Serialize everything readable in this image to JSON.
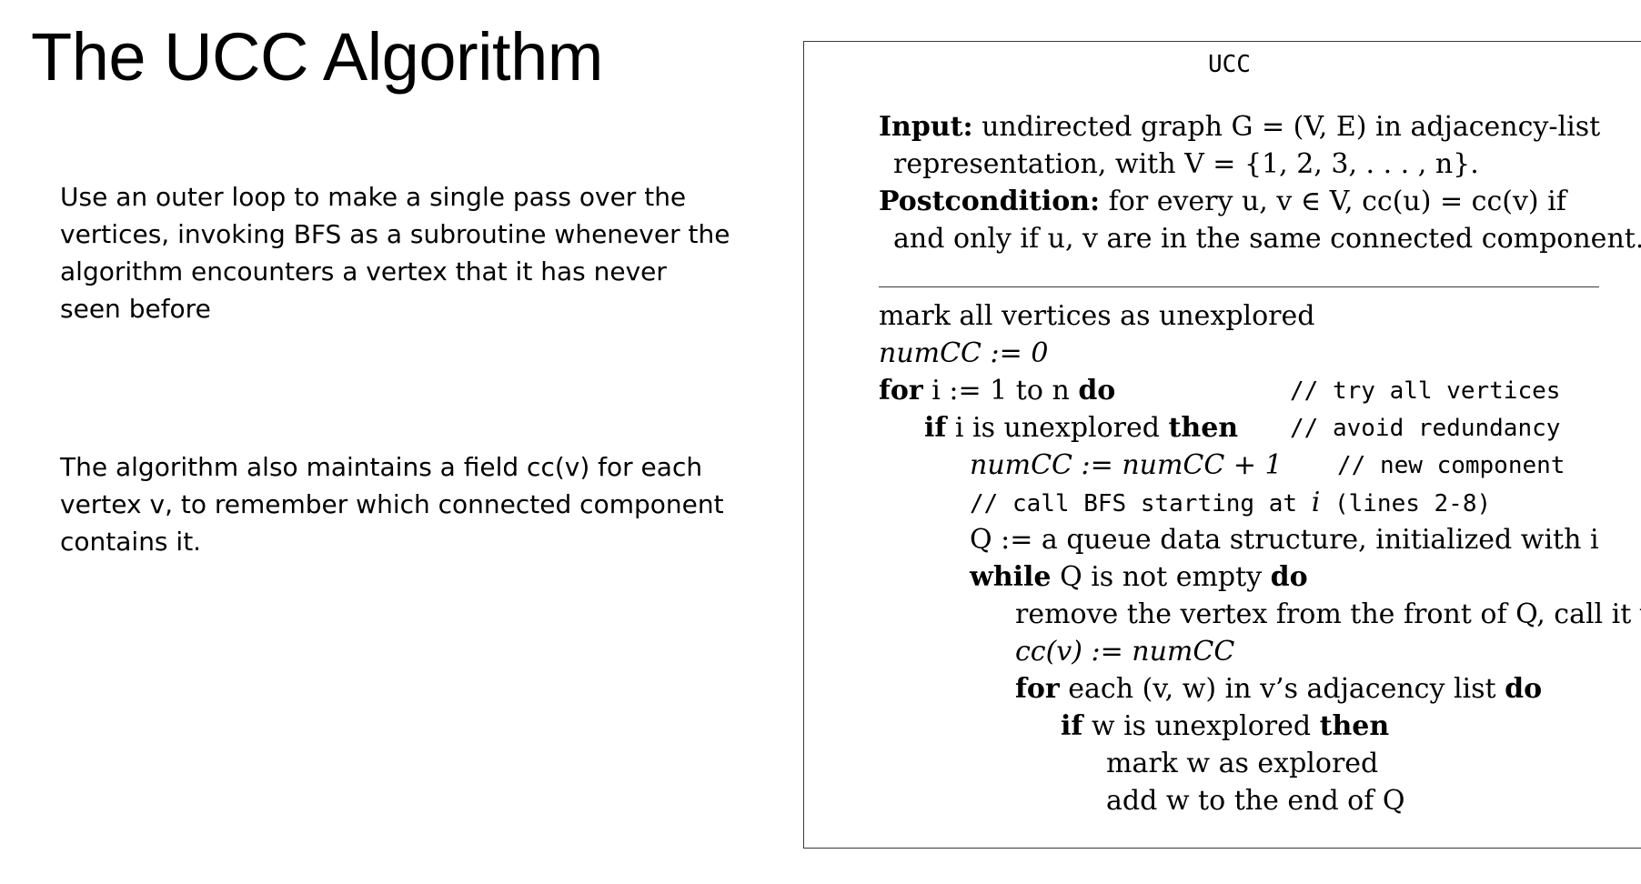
{
  "slide": {
    "title": "The UCC Algorithm",
    "paragraph_1": "Use an outer loop to make a single pass over the vertices, invoking BFS as a subroutine whenever the algorithm encounters a vertex that it has never seen before",
    "paragraph_2": "The algorithm also maintains a field cc(v) for each vertex v, to remember which connected component contains it."
  },
  "algorithm": {
    "name": "UCC",
    "input_label": "Input:",
    "input_text_1": " undirected graph G = (V, E) in adjacency-list",
    "input_text_2": "representation, with V = {1, 2, 3, . . . , n}.",
    "post_label": "Postcondition:",
    "post_text_1": " for every u, v ∈ V, cc(u) = cc(v) if",
    "post_text_2": "and only if u, v are in the same connected component.",
    "lines": {
      "l1": "mark all vertices as unexplored",
      "l2": "numCC := 0",
      "l3_kw1": "for",
      "l3_mid": " i := 1 to n ",
      "l3_kw2": "do",
      "l3_comment": "// try all vertices",
      "l4_kw1": "if",
      "l4_mid": " i is unexplored ",
      "l4_kw2": "then",
      "l4_comment": "// avoid redundancy",
      "l5": "numCC := numCC + 1",
      "l5_comment": "// new component",
      "l6_a": "// call BFS starting at ",
      "l6_i": "i",
      "l6_b": " (lines 2-8)",
      "l7": "Q := a queue data structure, initialized with i",
      "l8_kw1": "while",
      "l8_mid": " Q is not empty ",
      "l8_kw2": "do",
      "l9": "remove the vertex from the front of Q, call it v",
      "l10": "cc(v) := numCC",
      "l11_kw1": "for",
      "l11_mid": " each (v, w) in v’s adjacency list ",
      "l11_kw2": "do",
      "l12_kw1": "if",
      "l12_mid": " w is unexplored ",
      "l12_kw2": "then",
      "l13": "mark w as explored",
      "l14": "add w to the end of Q"
    }
  }
}
